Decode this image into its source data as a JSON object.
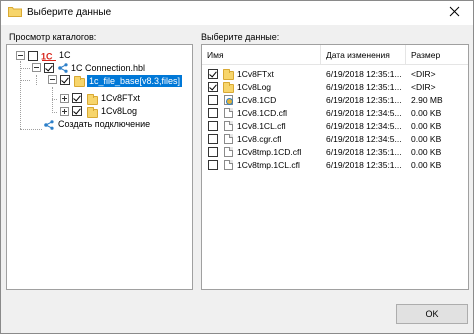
{
  "window": {
    "title": "Выберите данные",
    "close_icon": "close-icon"
  },
  "left": {
    "label": "Просмотр каталогов:",
    "root": {
      "label": "1C",
      "icon": "1c-logo-icon"
    },
    "connection": {
      "label": "1C Connection.hbl",
      "icon": "share-icon"
    },
    "base": {
      "label": "1c_file_base[v8.3,files]",
      "icon": "folder-icon"
    },
    "children": [
      {
        "label": "1Cv8FTxt",
        "icon": "folder-icon"
      },
      {
        "label": "1Cv8Log",
        "icon": "folder-icon"
      }
    ],
    "create": {
      "label": "Создать подключение",
      "icon": "share-icon"
    }
  },
  "right": {
    "label": "Выберите данные:",
    "columns": [
      "Имя",
      "Дата изменения",
      "Размер"
    ],
    "rows": [
      {
        "name": "1Cv8FTxt",
        "date": "6/19/2018 12:35:1...",
        "size": "<DIR>",
        "icon": "folder-icon",
        "checked": true
      },
      {
        "name": "1Cv8Log",
        "date": "6/19/2018 12:35:1...",
        "size": "<DIR>",
        "icon": "folder-icon",
        "checked": true
      },
      {
        "name": "1Cv8.1CD",
        "date": "6/19/2018 12:35:1...",
        "size": "2.90 MB",
        "icon": "database-icon",
        "checked": false
      },
      {
        "name": "1Cv8.1CD.cfl",
        "date": "6/19/2018 12:34:5...",
        "size": "0.00 KB",
        "icon": "file-icon",
        "checked": false
      },
      {
        "name": "1Cv8.1CL.cfl",
        "date": "6/19/2018 12:34:5...",
        "size": "0.00 KB",
        "icon": "file-icon",
        "checked": false
      },
      {
        "name": "1Cv8.cgr.cfl",
        "date": "6/19/2018 12:34:5...",
        "size": "0.00 KB",
        "icon": "file-icon",
        "checked": false
      },
      {
        "name": "1Cv8tmp.1CD.cfl",
        "date": "6/19/2018 12:35:1...",
        "size": "0.00 KB",
        "icon": "file-icon",
        "checked": false
      },
      {
        "name": "1Cv8tmp.1CL.cfl",
        "date": "6/19/2018 12:35:1...",
        "size": "0.00 KB",
        "icon": "file-icon",
        "checked": false
      }
    ]
  },
  "footer": {
    "ok_label": "OK"
  },
  "colors": {
    "selection": "#0078d7",
    "folder": "#f7d56b",
    "brand_red": "#d8261c",
    "share_blue": "#2c7fc9"
  }
}
